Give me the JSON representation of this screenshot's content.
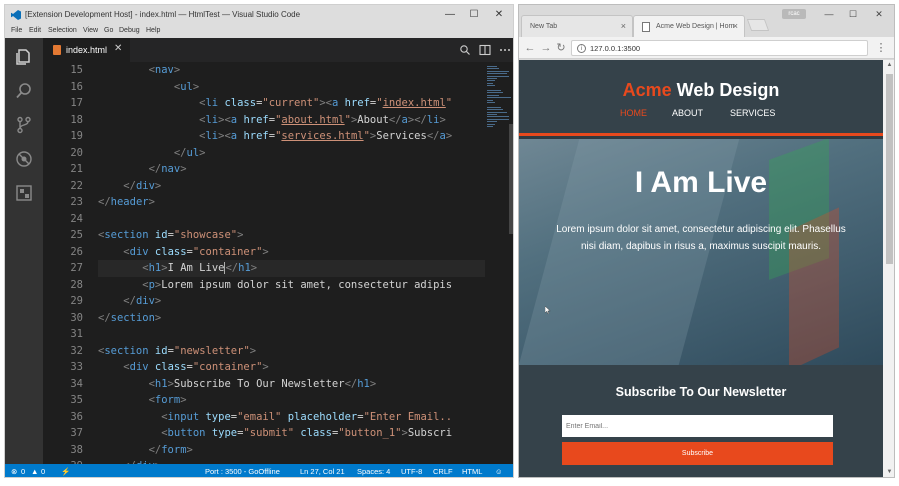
{
  "vscode": {
    "title": "[Extension Development Host] - index.html — HtmlTest — Visual Studio Code",
    "menu": [
      "File",
      "Edit",
      "Selection",
      "View",
      "Go",
      "Debug",
      "Help"
    ],
    "tab_label": "index.html",
    "tab_close": "✕",
    "window_controls": {
      "minimize": "—",
      "maximize": "☐",
      "close": "✕"
    },
    "activity_icons": [
      "files-icon",
      "search-icon",
      "source-control-icon",
      "debug-icon",
      "extensions-icon"
    ],
    "line_numbers": [
      "15",
      "16",
      "17",
      "18",
      "19",
      "20",
      "21",
      "22",
      "23",
      "24",
      "25",
      "26",
      "27",
      "28",
      "29",
      "30",
      "31",
      "32",
      "33",
      "34",
      "35",
      "36",
      "37",
      "38",
      "39"
    ],
    "status": {
      "errors": "0",
      "warnings": "0",
      "port": "Port : 3500 - GoOffline",
      "position": "Ln 27, Col 21",
      "spaces": "Spaces: 4",
      "encoding": "UTF-8",
      "eol": "CRLF",
      "language": "HTML"
    }
  },
  "chrome": {
    "tabs": [
      {
        "label": "New Tab",
        "close": "×"
      },
      {
        "label": "Acme Web Design | Hom",
        "close": "×"
      }
    ],
    "user_badge": "rcac",
    "window_controls": {
      "minimize": "—",
      "maximize": "☐",
      "close": "✕"
    },
    "url": "127.0.0.1:3500"
  },
  "site": {
    "brand_highlight": "Acme",
    "brand_rest": " Web Design",
    "nav": [
      "HOME",
      "ABOUT",
      "SERVICES"
    ],
    "showcase_title": "I Am Live",
    "showcase_text": "Lorem ipsum dolor sit amet, consectetur adipiscing elit. Phasellus nisi diam, dapibus in risus a, maximus suscipit mauris.",
    "newsletter_title": "Subscribe To Our Newsletter",
    "email_placeholder": "Enter Email...",
    "subscribe_label": "Subscribe"
  },
  "colors": {
    "accent": "#e8491d",
    "site_dark": "#35424a",
    "vscode_status": "#007acc",
    "editor_bg": "#1e1e1e"
  }
}
